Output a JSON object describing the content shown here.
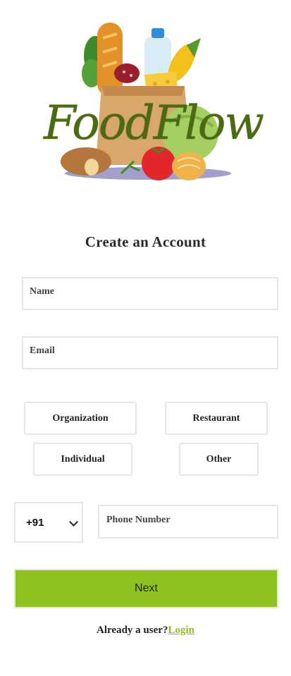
{
  "brand": {
    "logo_text": "FoodFlow",
    "logo_color": "#4a6b12"
  },
  "form": {
    "title": "Create an Account",
    "name_placeholder": "Name",
    "email_placeholder": "Email",
    "types": [
      "Organization",
      "Restaurant",
      "Individual",
      "Other"
    ],
    "country_code": "+91",
    "phone_placeholder": "Phone Number",
    "next_label": "Next",
    "already_text": "Already a user?",
    "login_label": "Login"
  },
  "colors": {
    "accent": "#8dc21f",
    "border": "#e6e6e6"
  }
}
